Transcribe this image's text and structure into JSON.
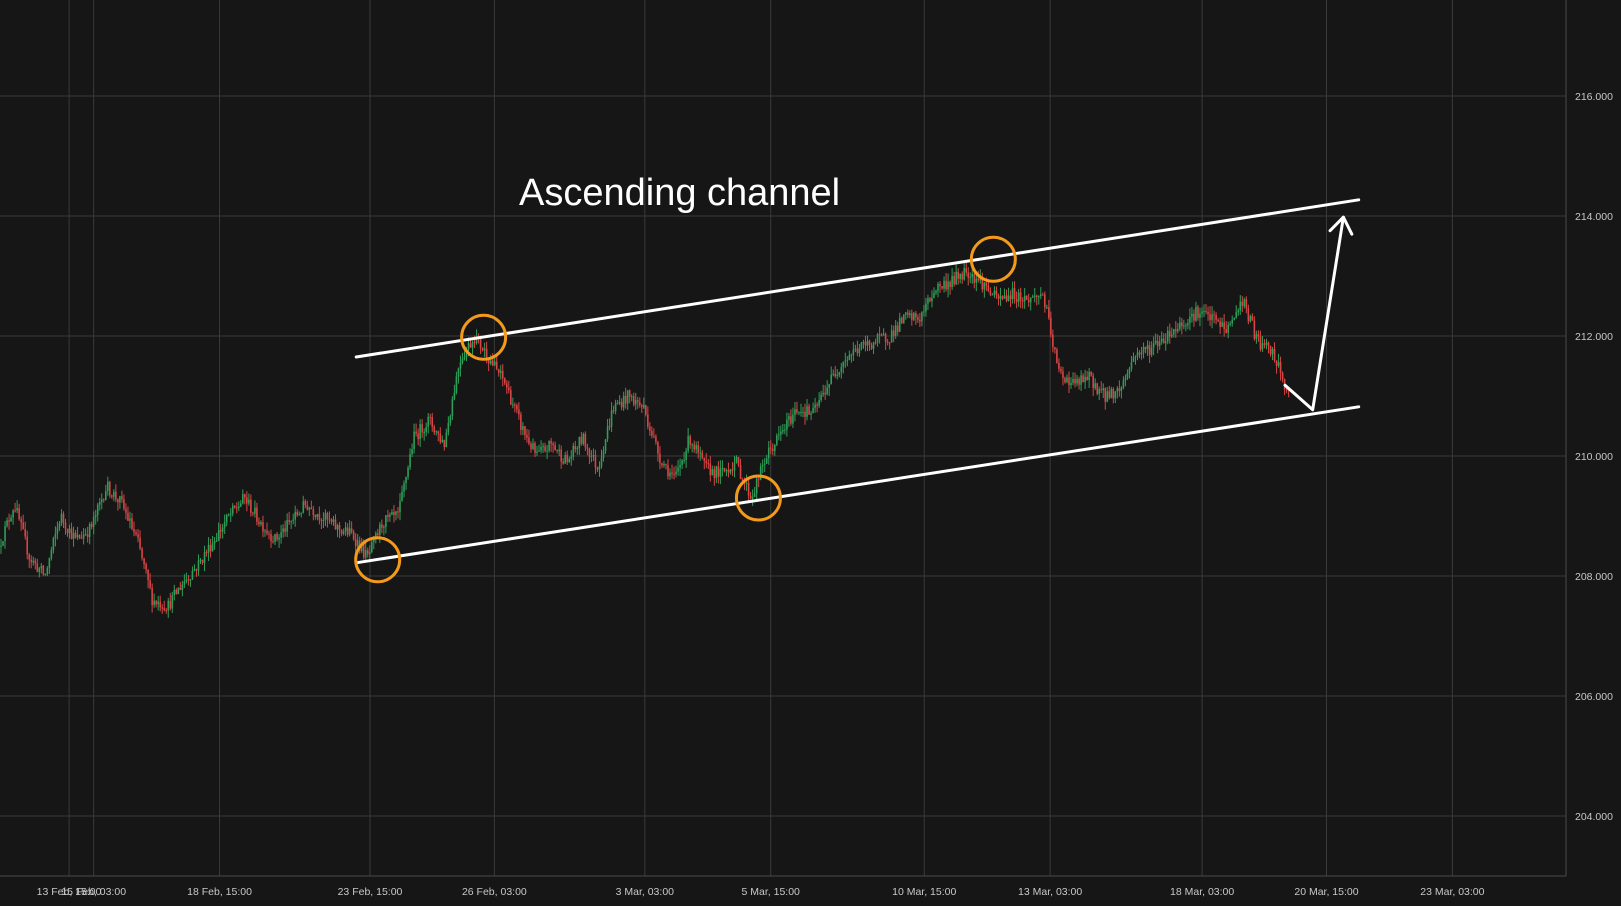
{
  "chart_data": {
    "type": "candlestick",
    "title": "Ascending channel",
    "ylim": [
      203,
      217.6
    ],
    "xlim": [
      0,
      102
    ],
    "y_ticks": [
      216,
      214,
      212,
      210,
      208,
      206,
      204
    ],
    "y_tick_labels": [
      "216.000",
      "214.000",
      "212.000",
      "210.000",
      "208.000",
      "206.000",
      "204.000"
    ],
    "x_ticks": [
      {
        "label": "13 Feb, 15:00",
        "x": 4.5
      },
      {
        "label": "15 Feb, 03:00",
        "x": 6.1
      },
      {
        "label": "18 Feb, 15:00",
        "x": 14.3
      },
      {
        "label": "23 Feb, 15:00",
        "x": 24.1
      },
      {
        "label": "26 Feb, 03:00",
        "x": 32.2
      },
      {
        "label": "3 Mar, 03:00",
        "x": 42.0
      },
      {
        "label": "5 Mar, 15:00",
        "x": 50.2
      },
      {
        "label": "10 Mar, 15:00",
        "x": 60.2
      },
      {
        "label": "13 Mar, 03:00",
        "x": 68.4
      },
      {
        "label": "18 Mar, 03:00",
        "x": 78.3
      },
      {
        "label": "20 Mar, 15:00",
        "x": 86.4
      },
      {
        "label": "23 Mar, 03:00",
        "x": 94.6
      }
    ],
    "price_path": [
      [
        0,
        208.5
      ],
      [
        1,
        209.2
      ],
      [
        2,
        208.3
      ],
      [
        3,
        208.0
      ],
      [
        4,
        209.0
      ],
      [
        5,
        208.6
      ],
      [
        6,
        208.8
      ],
      [
        7,
        209.5
      ],
      [
        8,
        209.2
      ],
      [
        9,
        208.6
      ],
      [
        10,
        207.6
      ],
      [
        11,
        207.5
      ],
      [
        12,
        207.9
      ],
      [
        13,
        208.2
      ],
      [
        14,
        208.6
      ],
      [
        15,
        209.0
      ],
      [
        16,
        209.3
      ],
      [
        17,
        208.9
      ],
      [
        18,
        208.6
      ],
      [
        19,
        208.9
      ],
      [
        20,
        209.2
      ],
      [
        21,
        209.0
      ],
      [
        22,
        208.8
      ],
      [
        23,
        208.7
      ],
      [
        24,
        208.3
      ],
      [
        25,
        208.9
      ],
      [
        26,
        209.0
      ],
      [
        27,
        210.3
      ],
      [
        28,
        210.6
      ],
      [
        29,
        210.2
      ],
      [
        30,
        211.6
      ],
      [
        31,
        212.0
      ],
      [
        32,
        211.6
      ],
      [
        33,
        211.2
      ],
      [
        34,
        210.5
      ],
      [
        35,
        210.0
      ],
      [
        36,
        210.2
      ],
      [
        37,
        209.9
      ],
      [
        38,
        210.3
      ],
      [
        39,
        209.8
      ],
      [
        40,
        210.8
      ],
      [
        41,
        211.0
      ],
      [
        42,
        210.8
      ],
      [
        43,
        210.0
      ],
      [
        44,
        209.6
      ],
      [
        45,
        210.3
      ],
      [
        46,
        209.8
      ],
      [
        47,
        209.7
      ],
      [
        48,
        209.9
      ],
      [
        49,
        209.3
      ],
      [
        50,
        210.0
      ],
      [
        51,
        210.4
      ],
      [
        52,
        210.8
      ],
      [
        53,
        210.7
      ],
      [
        54,
        211.2
      ],
      [
        55,
        211.6
      ],
      [
        56,
        211.8
      ],
      [
        57,
        211.9
      ],
      [
        58,
        212.0
      ],
      [
        59,
        212.3
      ],
      [
        60,
        212.3
      ],
      [
        61,
        212.8
      ],
      [
        62,
        212.9
      ],
      [
        63,
        213.1
      ],
      [
        64,
        212.9
      ],
      [
        65,
        212.6
      ],
      [
        66,
        212.7
      ],
      [
        67,
        212.6
      ],
      [
        68,
        212.7
      ],
      [
        69,
        211.4
      ],
      [
        70,
        211.2
      ],
      [
        71,
        211.3
      ],
      [
        72,
        211.0
      ],
      [
        73,
        211.1
      ],
      [
        74,
        211.7
      ],
      [
        75,
        211.8
      ],
      [
        76,
        212.0
      ],
      [
        77,
        212.2
      ],
      [
        78,
        212.4
      ],
      [
        79,
        212.3
      ],
      [
        80,
        212.1
      ],
      [
        81,
        212.6
      ],
      [
        82,
        211.9
      ],
      [
        83,
        211.7
      ],
      [
        84,
        211.0
      ]
    ],
    "channel": {
      "upper": [
        [
          23.2,
          211.65
        ],
        [
          88.5,
          214.27
        ]
      ],
      "lower": [
        [
          23.2,
          208.22
        ],
        [
          88.5,
          210.82
        ]
      ]
    },
    "projection_arrow": [
      [
        83.7,
        211.18
      ],
      [
        85.5,
        210.77
      ],
      [
        87.5,
        213.98
      ]
    ],
    "touch_points": [
      [
        24.6,
        208.27
      ],
      [
        31.5,
        211.98
      ],
      [
        49.4,
        209.3
      ],
      [
        64.7,
        213.28
      ]
    ],
    "colors": {
      "background": "#161616",
      "grid": "#3a3a3a",
      "up_candle": "#2e9e58",
      "down_candle": "#d84545",
      "lines": "#ffffff",
      "markers": "#f39a1c",
      "text": "#c8c8c8"
    }
  }
}
